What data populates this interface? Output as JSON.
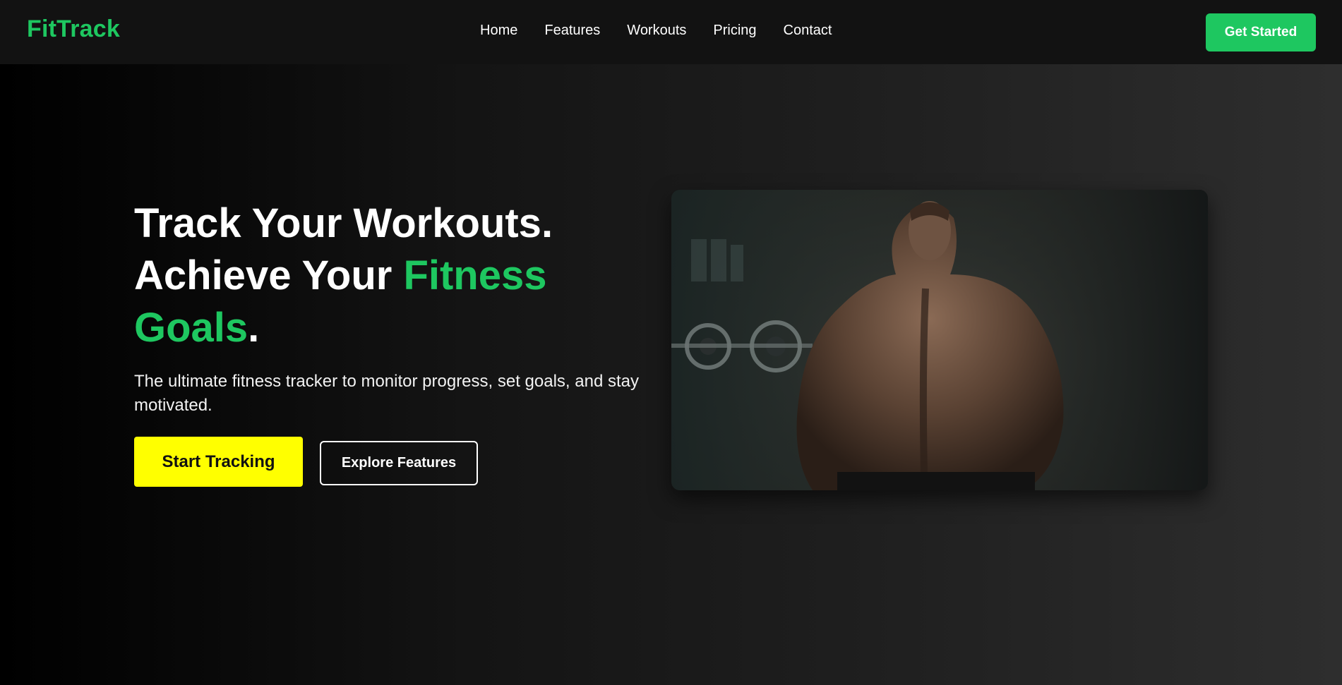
{
  "brand": {
    "name": "FitTrack"
  },
  "nav": {
    "links": [
      "Home",
      "Features",
      "Workouts",
      "Pricing",
      "Contact"
    ],
    "cta_label": "Get Started"
  },
  "hero": {
    "title_line1": "Track Your Workouts.",
    "title_line2_plain": "Achieve Your ",
    "title_accent": "Fitness Goals",
    "title_end": ".",
    "subtitle": "The ultimate fitness tracker to monitor progress, set goals, and stay motivated.",
    "primary_button": "Start Tracking",
    "secondary_button": "Explore Features"
  },
  "colors": {
    "accent_green": "#1ec760",
    "primary_yellow": "#ffff00",
    "nav_bg": "#121212"
  }
}
